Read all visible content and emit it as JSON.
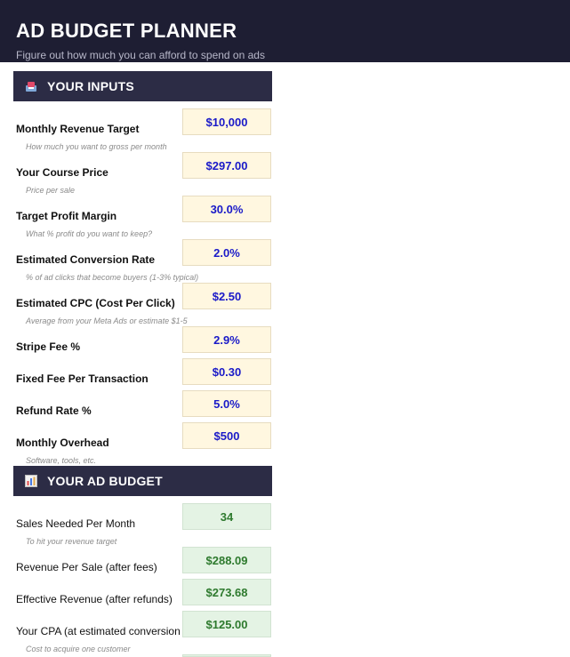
{
  "header": {
    "title": "AD BUDGET PLANNER",
    "subtitle": "Figure out how much you can afford to spend on ads"
  },
  "inputs_section": {
    "title": "YOUR INPUTS",
    "icon": "inbox-tray-icon",
    "rows": [
      {
        "label": "Monthly Revenue Target",
        "value": "$10,000",
        "hint": "How much you want to gross per month"
      },
      {
        "label": "Your Course Price",
        "value": "$297.00",
        "hint": "Price per sale"
      },
      {
        "label": "Target Profit Margin",
        "value": "30.0%",
        "hint": "What % profit do you want to keep?"
      },
      {
        "label": "Estimated Conversion Rate",
        "value": "2.0%",
        "hint": "% of ad clicks that become buyers (1-3% typical)"
      },
      {
        "label": "Estimated CPC (Cost Per Click)",
        "value": "$2.50",
        "hint": "Average from your Meta Ads or estimate $1-5"
      },
      {
        "label": "Stripe Fee %",
        "value": "2.9%",
        "hint": ""
      },
      {
        "label": "Fixed Fee Per Transaction",
        "value": "$0.30",
        "hint": ""
      },
      {
        "label": "Refund Rate %",
        "value": "5.0%",
        "hint": ""
      },
      {
        "label": "Monthly Overhead",
        "value": "$500",
        "hint": "Software, tools, etc."
      }
    ]
  },
  "budget_section": {
    "title": "YOUR AD BUDGET",
    "icon": "bar-chart-icon",
    "rows": [
      {
        "label": "Sales Needed Per Month",
        "value": "34",
        "hint": "To hit your revenue target"
      },
      {
        "label": "Revenue Per Sale (after fees)",
        "value": "$288.09",
        "hint": ""
      },
      {
        "label": "Effective Revenue (after refunds)",
        "value": "$273.68",
        "hint": ""
      },
      {
        "label": "Your CPA (at estimated conversion rate)",
        "value": "$125.00",
        "hint": "Cost to acquire one customer"
      }
    ]
  },
  "colors": {
    "header_bg": "#1e1e33",
    "section_bg": "#2c2c45",
    "input_bg": "#fff7e0",
    "input_text": "#1a1ac8",
    "output_bg": "#e4f3e4",
    "output_text": "#2e7a2e"
  }
}
